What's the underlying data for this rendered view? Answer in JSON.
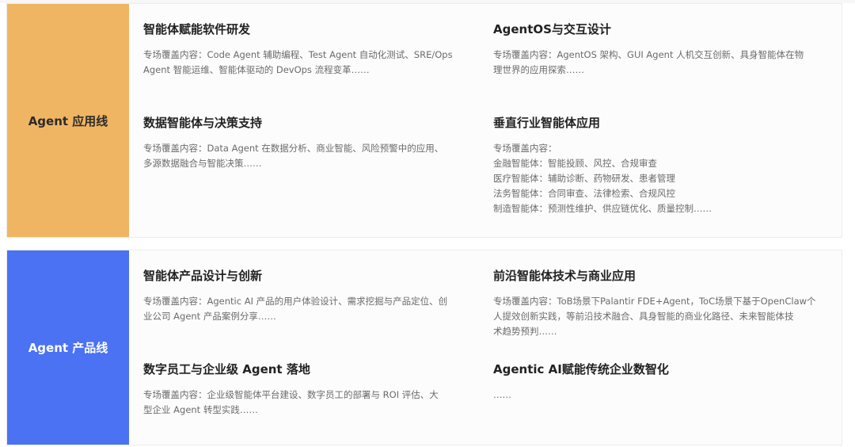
{
  "sections": [
    {
      "label": "Agent 应用线",
      "color": "#f0b562",
      "topics": [
        {
          "title": "智能体赋能软件研发",
          "desc": [
            "专场覆盖内容：Code Agent 辅助编程、Test Agent 自动化测试、SRE/Ops",
            "Agent 智能运维、智能体驱动的 DevOps 流程变革……"
          ]
        },
        {
          "title": "AgentOS与交互设计",
          "desc": [
            "专场覆盖内容：AgentOS 架构、GUI Agent 人机交互创新、具身智能体在物",
            "理世界的应用探索……"
          ]
        },
        {
          "title": "数据智能体与决策支持",
          "desc": [
            "专场覆盖内容：Data Agent 在数据分析、商业智能、风险预警中的应用、",
            "多源数据融合与智能决策……"
          ]
        },
        {
          "title": "垂直行业智能体应用",
          "desc": [
            "专场覆盖内容：",
            "金融智能体：智能投顾、风控、合规审查",
            "医疗智能体：辅助诊断、药物研发、患者管理",
            "法务智能体：合同审查、法律检索、合规风控",
            "制造智能体：预测性维护、供应链优化、质量控制……"
          ]
        }
      ]
    },
    {
      "label": "Agent 产品线",
      "color": "#4a72f3",
      "topics": [
        {
          "title": "智能体产品设计与创新",
          "desc": [
            "专场覆盖内容：Agentic AI 产品的用户体验设计、需求挖掘与产品定位、创",
            "业公司 Agent 产品案例分享……"
          ]
        },
        {
          "title": "前沿智能体技术与商业应用",
          "desc": [
            "专场覆盖内容：ToB场景下Palantir FDE+Agent，ToC场景下基于OpenClaw个",
            "人提效创新实践，等前沿技术融合、具身智能的商业化路径、未来智能体技",
            "术趋势预判……"
          ]
        },
        {
          "title": "数字员工与企业级 Agent 落地",
          "desc": [
            "专场覆盖内容：企业级智能体平台建设、数字员工的部署与 ROI 评估、大",
            "型企业 Agent 转型实践……"
          ]
        },
        {
          "title": "Agentic AI赋能传统企业数智化",
          "desc": [
            "……"
          ]
        }
      ]
    }
  ]
}
